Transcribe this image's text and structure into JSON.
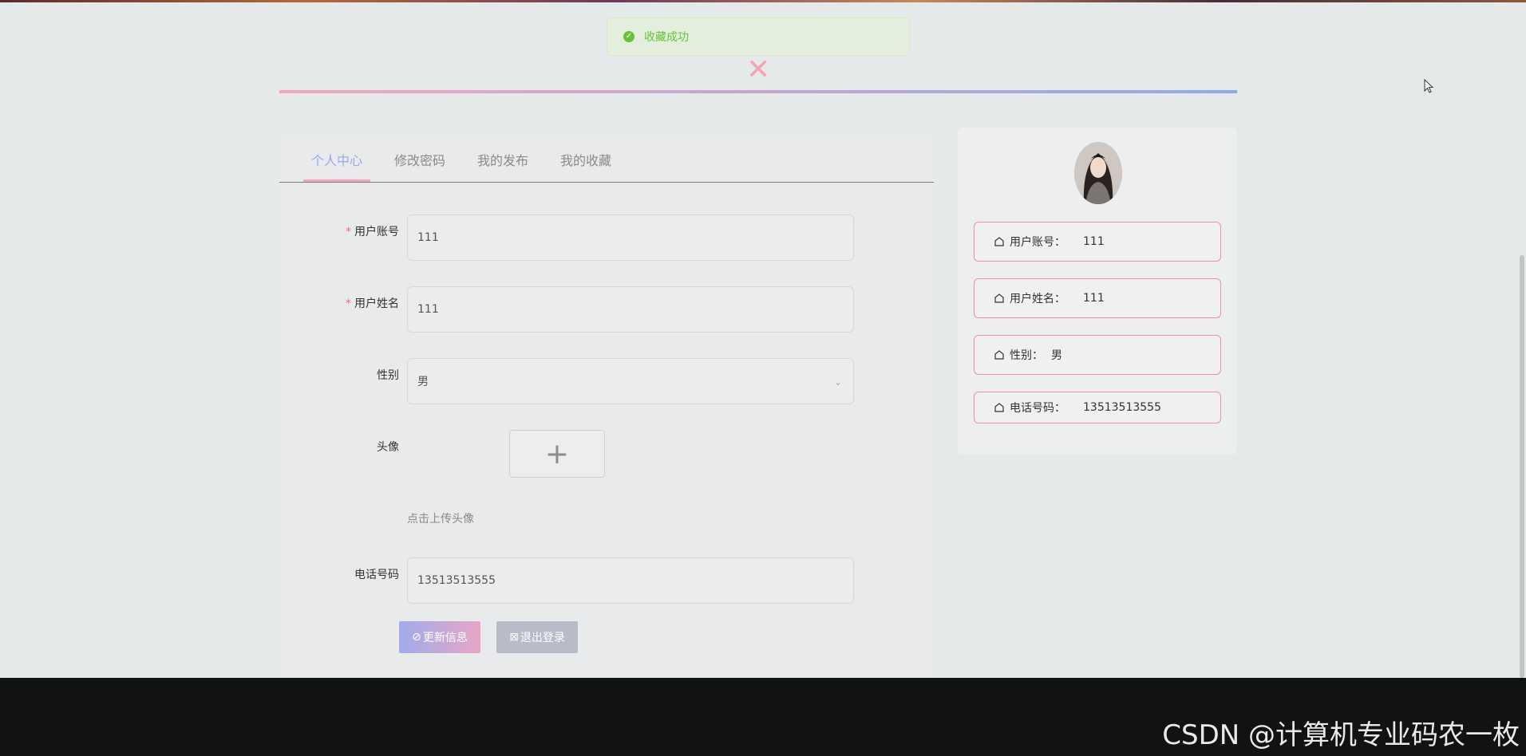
{
  "toast": {
    "message": "收藏成功"
  },
  "tabs": [
    {
      "label": "个人中心"
    },
    {
      "label": "修改密码"
    },
    {
      "label": "我的发布"
    },
    {
      "label": "我的收藏"
    }
  ],
  "form": {
    "account": {
      "label": "用户账号",
      "value": "111",
      "required": true
    },
    "name": {
      "label": "用户姓名",
      "value": "111",
      "required": true
    },
    "gender": {
      "label": "性别",
      "value": "男"
    },
    "avatar": {
      "label": "头像",
      "hint": "点击上传头像"
    },
    "phone": {
      "label": "电话号码",
      "value": "13513513555"
    },
    "buttons": {
      "update": "更新信息",
      "logout": "退出登录"
    }
  },
  "profile_card": {
    "account": {
      "label": "用户账号：",
      "value": "111"
    },
    "name": {
      "label": "用户姓名：",
      "value": "111"
    },
    "gender": {
      "label": "性别：",
      "value": "男"
    },
    "phone": {
      "label": "电话号码：",
      "value": "13513513555"
    }
  },
  "colors": {
    "accent_pink": "#f3a7bc",
    "accent_blue": "#8ea9ef",
    "success": "#67c23a"
  },
  "watermark": "CSDN @计算机专业码农一枚"
}
